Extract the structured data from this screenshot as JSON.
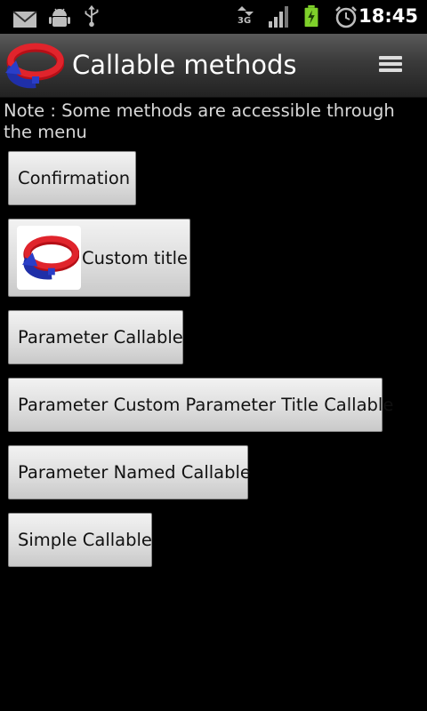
{
  "status_bar": {
    "time": "18:45",
    "network_type": "3G",
    "icons": [
      "gmail-icon",
      "android-debug-icon",
      "usb-icon",
      "data-arrows-icon",
      "signal-icon",
      "battery-charging-icon",
      "alarm-icon"
    ]
  },
  "header": {
    "title": "Callable methods",
    "logo_icon": "app-logo-icon",
    "menu_icon": "overflow-menu-icon"
  },
  "main": {
    "note": "Note : Some methods are accessible through the menu",
    "buttons": [
      {
        "label": "Confirmation"
      },
      {
        "label": "Custom title",
        "icon": "app-logo-icon"
      },
      {
        "label": "Parameter Callable"
      },
      {
        "label": "Parameter Custom Parameter Title Callable"
      },
      {
        "label": "Parameter Named Callable"
      },
      {
        "label": "Simple Callable"
      }
    ]
  },
  "colors": {
    "background": "#000000",
    "button_face": "#dcdcdc",
    "logo_red": "#d4141c",
    "logo_blue": "#2a3ec8",
    "battery_green": "#7fd12a"
  }
}
